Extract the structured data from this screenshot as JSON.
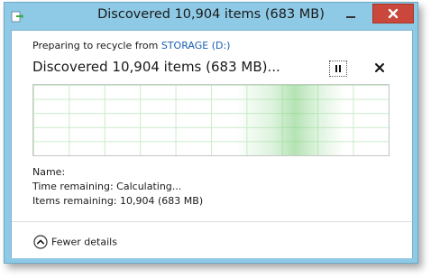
{
  "window": {
    "title": "Discovered 10,904 items (683 MB)"
  },
  "operation": {
    "preparing_prefix": "Preparing to recycle from ",
    "source_link": "STORAGE (D:)",
    "status": "Discovered 10,904 items (683 MB)..."
  },
  "details": {
    "name_label": "Name:",
    "name_value": "",
    "time_label": "Time remaining:",
    "time_value": "Calculating...",
    "items_label": "Items remaining:",
    "items_value": "10,904 (683 MB)"
  },
  "footer": {
    "fewer_details_label": "Fewer details"
  },
  "colors": {
    "titlebar": "#8ecae6",
    "close_button": "#c9473b",
    "link": "#1a5fb4",
    "graph_grid": "#c9ecc9"
  },
  "icons": {
    "title": "recycle-file-icon",
    "minimize": "minimize-icon",
    "close": "close-icon",
    "pause": "pause-icon",
    "stop": "stop-x-icon",
    "fewer_details": "chevron-up-circle-icon"
  }
}
